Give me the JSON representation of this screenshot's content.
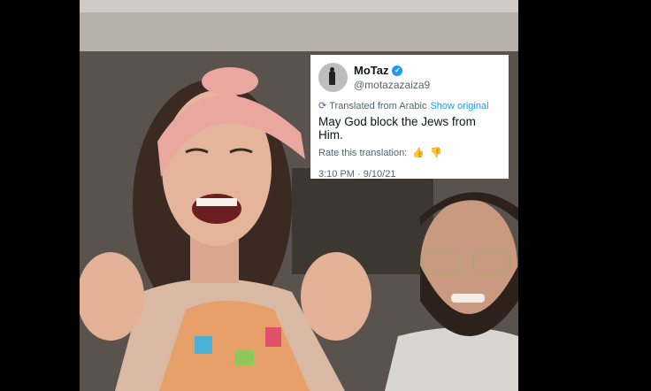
{
  "tweet": {
    "display_name": "MoTaz",
    "handle": "@motazazaiza9",
    "verified_glyph": "✓",
    "translated_label": "Translated from Arabic",
    "show_original_label": "Show original",
    "text": "May God block the Jews from Him.",
    "rate_label": "Rate this translation:",
    "thumbs_up_glyph": "👍",
    "thumbs_down_glyph": "👎",
    "timestamp": "3:10 PM · 9/10/21",
    "icons": [
      "verified-badge-icon",
      "translate-icon",
      "thumbs-up-icon",
      "thumbs-down-icon"
    ],
    "colors": {
      "link": "#1d9bf0",
      "secondary_text": "#536471",
      "primary_text": "#0f1419"
    }
  }
}
